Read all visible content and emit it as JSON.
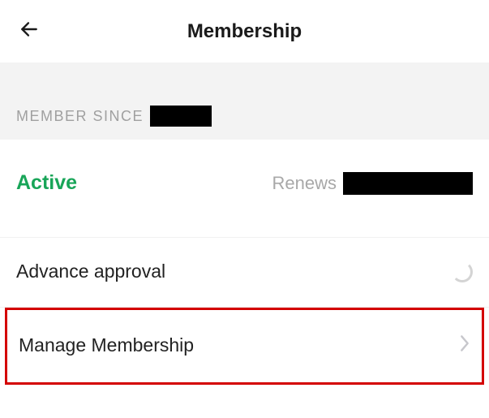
{
  "header": {
    "title": "Membership"
  },
  "member_since": {
    "label": "MEMBER SINCE"
  },
  "status": {
    "active_label": "Active",
    "renews_label": "Renews"
  },
  "rows": {
    "advance_approval_label": "Advance approval",
    "manage_membership_label": "Manage Membership"
  }
}
